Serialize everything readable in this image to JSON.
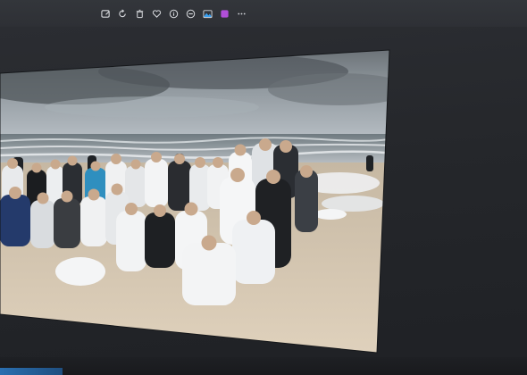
{
  "window": {
    "toolbar_icons": [
      {
        "name": "edit-icon"
      },
      {
        "name": "rotate-icon"
      },
      {
        "name": "delete-icon"
      },
      {
        "name": "favorite-icon"
      },
      {
        "name": "info-icon"
      },
      {
        "name": "compare-icon"
      },
      {
        "name": "enhance-icon"
      },
      {
        "name": "gallery-icon"
      },
      {
        "name": "more-icon"
      }
    ],
    "colors": {
      "bezel": "#2c2e33",
      "accent_purple": "#b14fd8",
      "accent_blue": "#3aa0f0"
    }
  },
  "photo": {
    "subject": "beach-group-photo"
  }
}
